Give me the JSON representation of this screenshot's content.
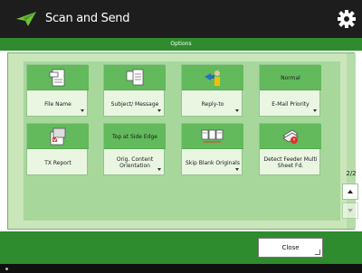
{
  "app": {
    "title": "Scan and Send"
  },
  "options_bar": {
    "label": "Options"
  },
  "buttons": [
    {
      "id": "file-name",
      "label": "File Name",
      "icon": "file-name-icon",
      "has_arrow": true
    },
    {
      "id": "subject-message",
      "label": "Subject/ Message",
      "icon": "subject-message-icon",
      "has_arrow": true
    },
    {
      "id": "reply-to",
      "label": "Reply-to",
      "icon": "reply-to-icon",
      "has_arrow": true
    },
    {
      "id": "email-priority",
      "label": "E-Mail Priority",
      "top_text": "Normal",
      "has_arrow": true
    },
    {
      "id": "tx-report",
      "label": "TX Report",
      "icon": "tx-report-icon",
      "has_arrow": false
    },
    {
      "id": "orig-content-orientation",
      "label": "Orig. Content Orientation",
      "top_text": "Top at Side Edge",
      "has_arrow": true
    },
    {
      "id": "skip-blank-originals",
      "label": "Skip Blank Originals",
      "icon": "skip-blank-originals-icon",
      "has_arrow": true
    },
    {
      "id": "detect-feeder-multi-sheet",
      "label": "Detect Feeder Multi Sheet Fd.",
      "icon": "detect-feeder-icon",
      "has_arrow": false
    }
  ],
  "pagination": {
    "text": "2/2"
  },
  "footer": {
    "close_label": "Close"
  },
  "colors": {
    "header": "#1d1d1d",
    "accent_green": "#2e8b2e",
    "panel": "#cbe6ba",
    "tile_icon": "#62ba5c"
  }
}
